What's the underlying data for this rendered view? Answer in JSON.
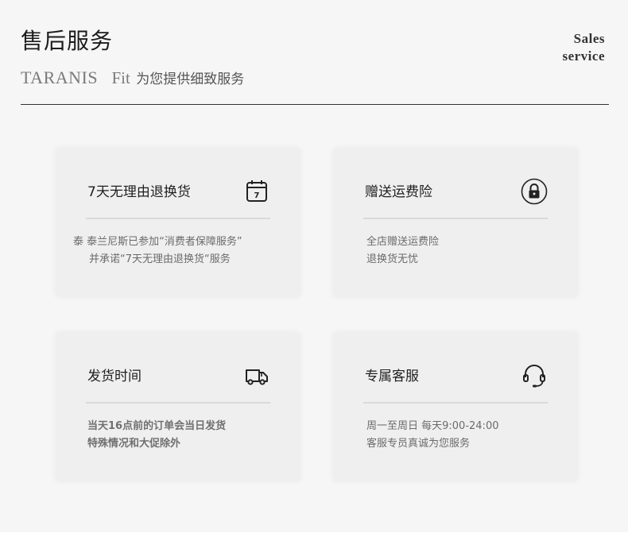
{
  "header": {
    "title": "售后服务",
    "brand": "TARANIS",
    "brand_fit": "Fit",
    "tagline": "为您提供细致服务",
    "en_label_line1": "Sales",
    "en_label_line2": "service"
  },
  "cards": [
    {
      "title": "7天无理由退换货",
      "icon": "calendar-7-icon",
      "desc_line1": "泰 泰兰尼斯已参加“消费者保障服务”",
      "desc_line2": "并承诺“7天无理由退换货“服务"
    },
    {
      "title": "赠送运费险",
      "icon": "lock-icon",
      "desc_line1": "全店赠送运费险",
      "desc_line2": "退换货无忧"
    },
    {
      "title": "发货时间",
      "icon": "truck-icon",
      "desc_line1": "当天16点前的订单会当日发货",
      "desc_line2": "特殊情况和大促除外"
    },
    {
      "title": "专属客服",
      "icon": "headset-icon",
      "desc_line1": "周一至周日  每天9:00-24:00",
      "desc_line2": "客服专员真诚为您服务"
    }
  ],
  "colors": {
    "background": "#f6f6f6",
    "card": "#efefef",
    "text_dark": "#1f1f1f",
    "text_muted": "#6b6b6b"
  }
}
